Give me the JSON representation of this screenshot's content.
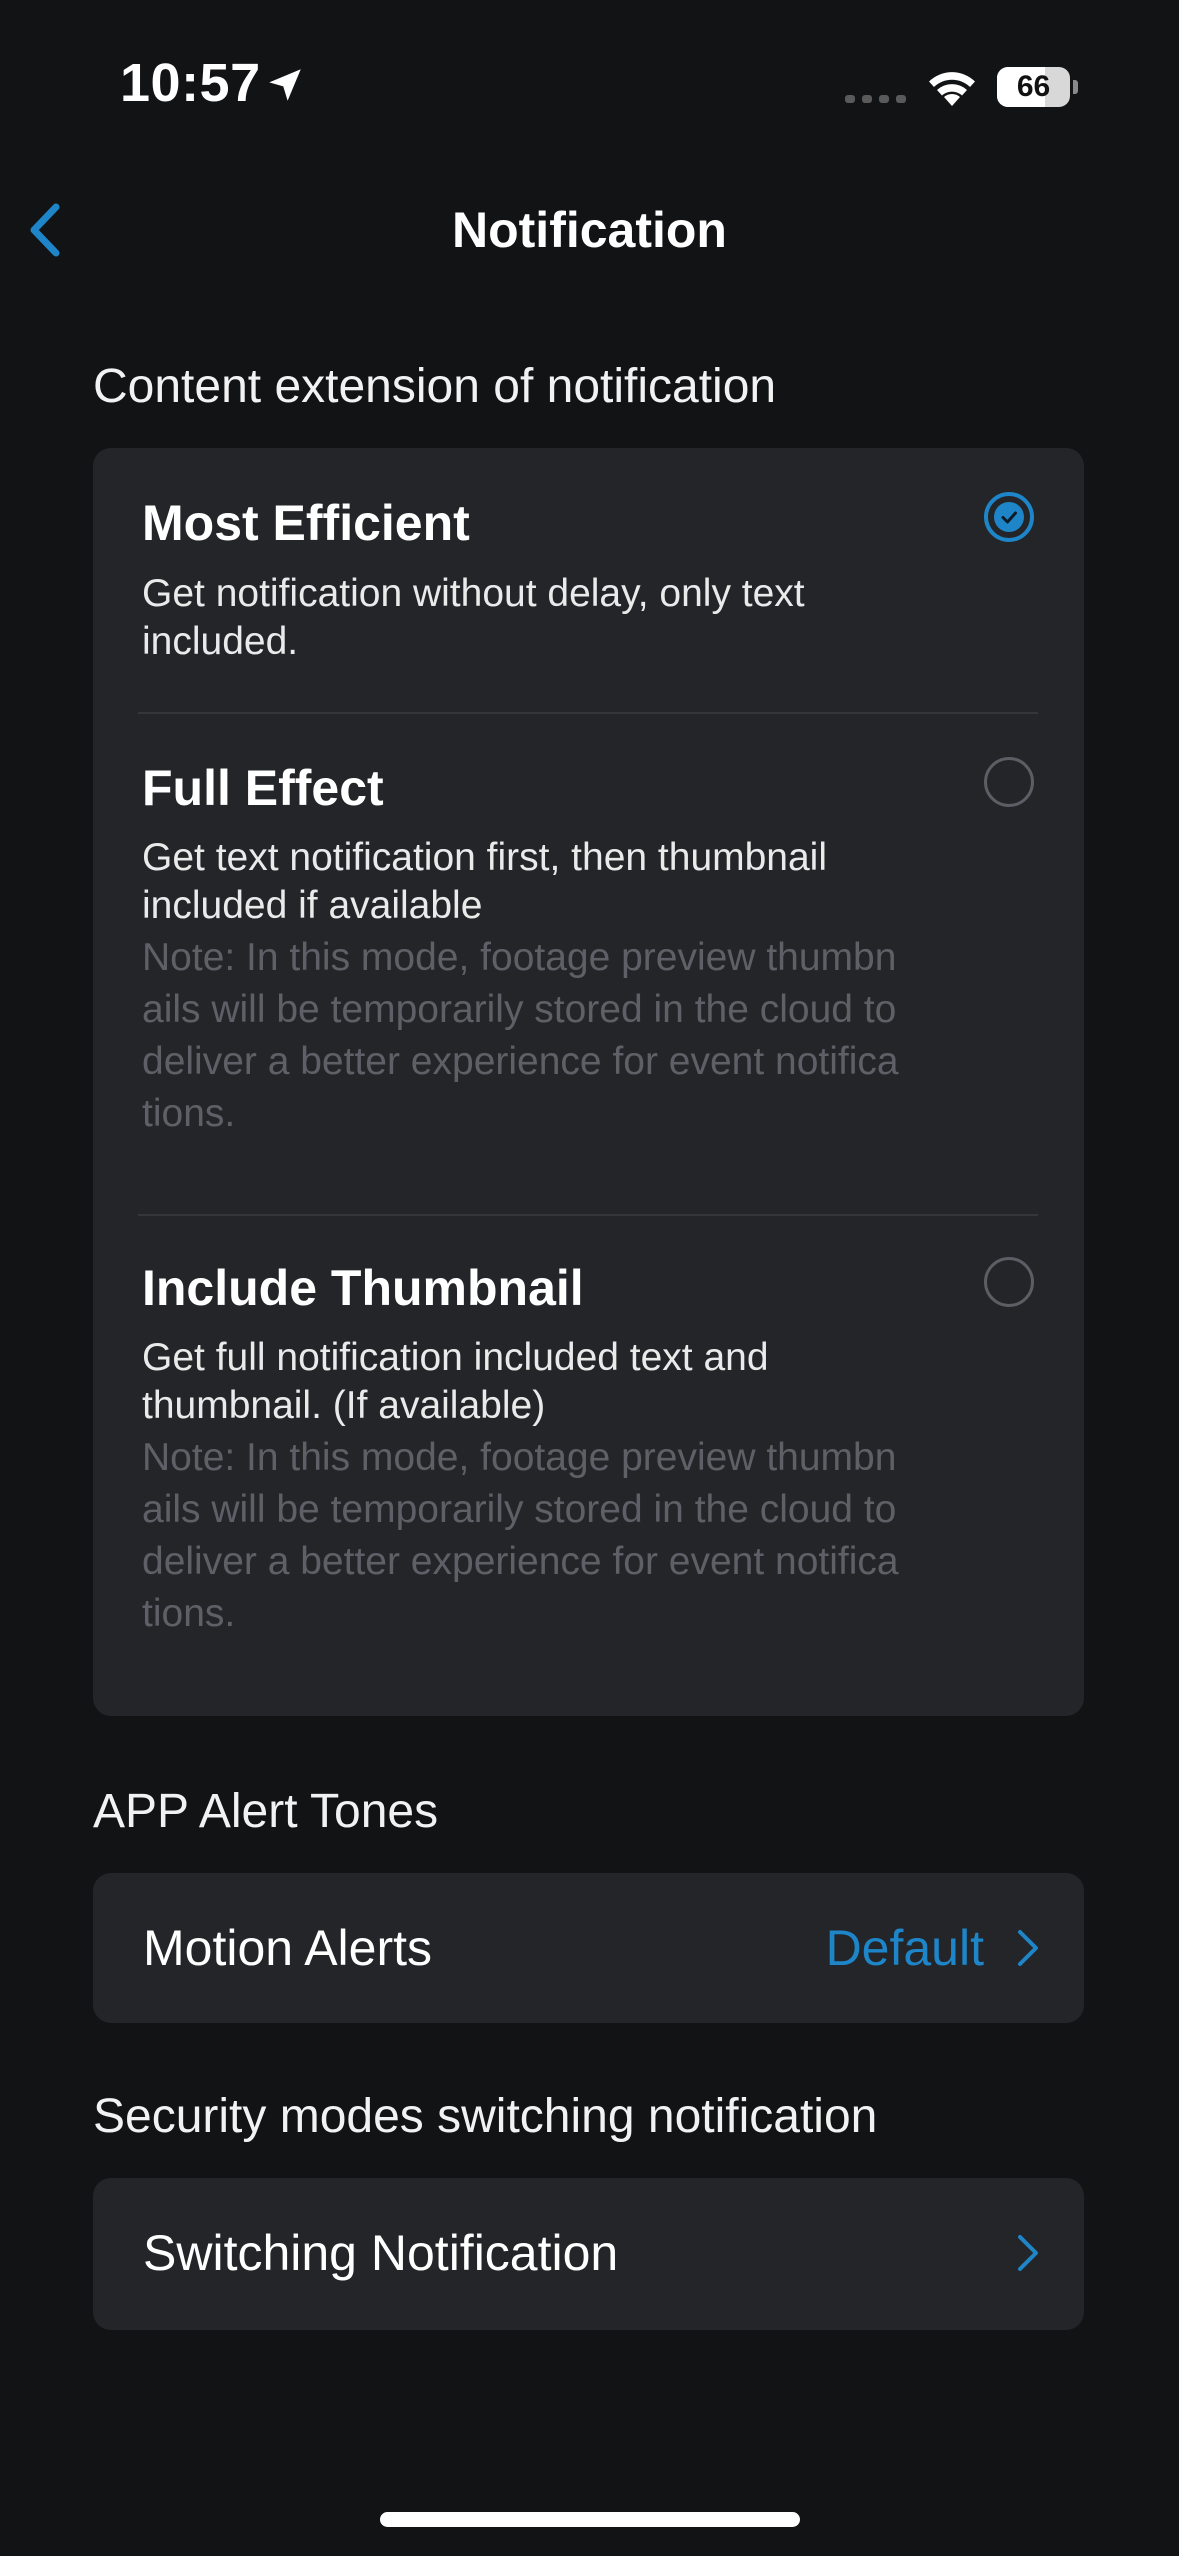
{
  "status_bar": {
    "time": "10:57",
    "battery_level": "66",
    "battery_fraction": 0.66
  },
  "nav": {
    "title": "Notification"
  },
  "content_extension": {
    "header": "Content extension of notification",
    "options": [
      {
        "title": "Most Efficient",
        "description": "Get notification without delay, only text included.",
        "note": "",
        "selected": true
      },
      {
        "title": "Full Effect",
        "description": "Get text notification first, then thumbnail included if available",
        "note": "Note: In this mode, footage preview thumbnails will be temporarily stored in the cloud to deliver a better experience for event notifications.",
        "selected": false
      },
      {
        "title": "Include Thumbnail",
        "description": "Get full notification included text and thumbnail. (If available)",
        "note": "Note: In this mode, footage preview thumbnails will be temporarily stored in the cloud to deliver a better experience for event notifications.",
        "selected": false
      }
    ]
  },
  "alert_tones": {
    "header": "APP Alert Tones",
    "row_label": "Motion Alerts",
    "row_value": "Default"
  },
  "security_modes": {
    "header": "Security modes switching notification",
    "row_label": "Switching Notification"
  },
  "colors": {
    "background": "#121315",
    "card": "#232528",
    "accent": "#1e86c8",
    "note_text": "#5d6066"
  },
  "icons": {
    "back": "chevron-left-icon",
    "row_arrow": "chevron-right-icon",
    "location": "location-arrow-icon",
    "wifi": "wifi-icon",
    "signal": "cellular-signal-icon",
    "battery": "battery-icon"
  }
}
